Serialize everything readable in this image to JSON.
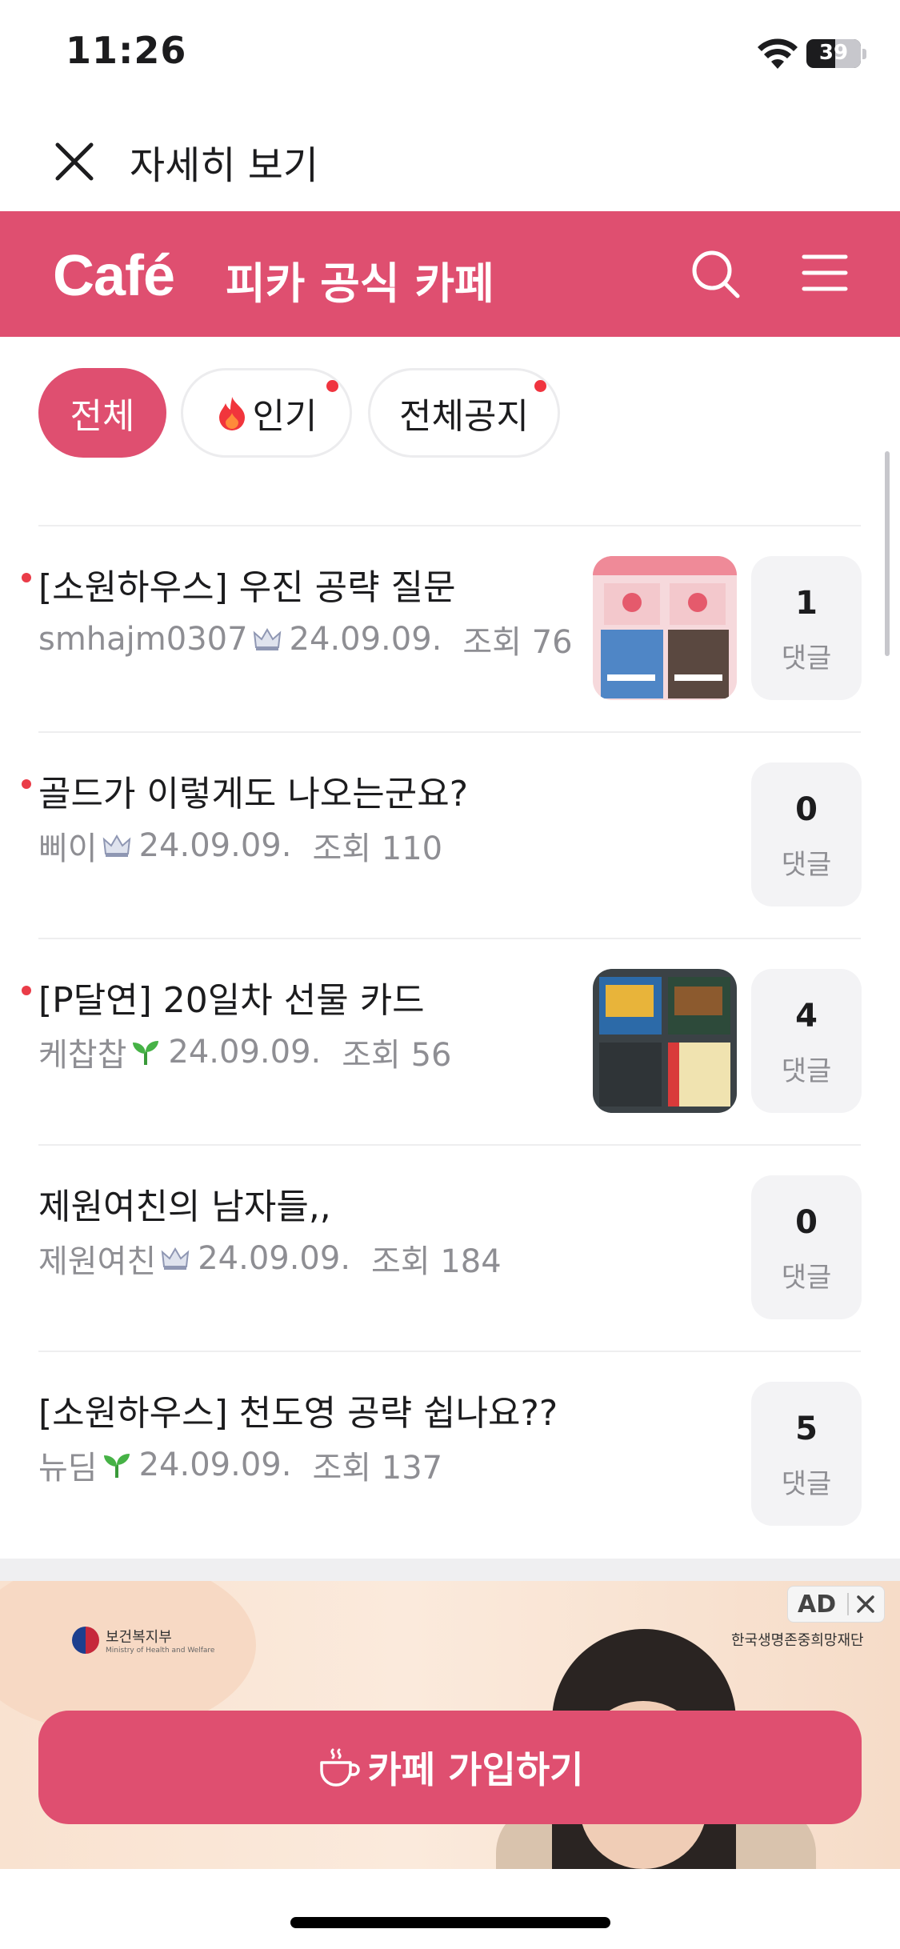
{
  "status_bar": {
    "time": "11:26",
    "battery": "39"
  },
  "top_nav": {
    "title": "자세히 보기"
  },
  "cafe_header": {
    "logo": "Café",
    "name": "피카 공식 카페"
  },
  "filters": [
    {
      "label": "전체",
      "active": true,
      "new_dot": false
    },
    {
      "label": "인기",
      "active": false,
      "new_dot": true,
      "icon": "fire-icon"
    },
    {
      "label": "전체공지",
      "active": false,
      "new_dot": true
    }
  ],
  "posts": [
    {
      "title": "[소원하우스] 우진 공략 질문",
      "author": "smhajm0307",
      "badge": "crown-badge",
      "date": "24.09.09.",
      "views": "조회 76",
      "comments": "1",
      "comments_label": "댓글",
      "unread": true,
      "has_thumb": true
    },
    {
      "title": "골드가 이렇게도 나오는군요?",
      "author": "삐이",
      "badge": "crown-badge",
      "date": "24.09.09.",
      "views": "조회 110",
      "comments": "0",
      "comments_label": "댓글",
      "unread": true,
      "has_thumb": false
    },
    {
      "title": "[P달연] 20일차 선물 카드",
      "author": "케찹찹",
      "badge": "sprout-badge",
      "date": "24.09.09.",
      "views": "조회 56",
      "comments": "4",
      "comments_label": "댓글",
      "unread": true,
      "has_thumb": true
    },
    {
      "title": "제원여친의 남자들,,",
      "author": "제원여친",
      "badge": "crown-badge",
      "date": "24.09.09.",
      "views": "조회 184",
      "comments": "0",
      "comments_label": "댓글",
      "unread": false,
      "has_thumb": false
    },
    {
      "title": "[소원하우스] 천도영 공략 쉽나요??",
      "author": "뉴딤",
      "badge": "sprout-badge",
      "date": "24.09.09.",
      "views": "조회 137",
      "comments": "5",
      "comments_label": "댓글",
      "unread": false,
      "has_thumb": false
    }
  ],
  "ad": {
    "tag": "AD",
    "org_left": "보건복지부",
    "org_left_en": "Ministry of Health and Welfare",
    "org_right": "한국생명존중희망재단"
  },
  "join_button": {
    "label": "카페 가입하기"
  },
  "colors": {
    "brand": "#df4f70",
    "unread_dot": "#ea3c48"
  }
}
